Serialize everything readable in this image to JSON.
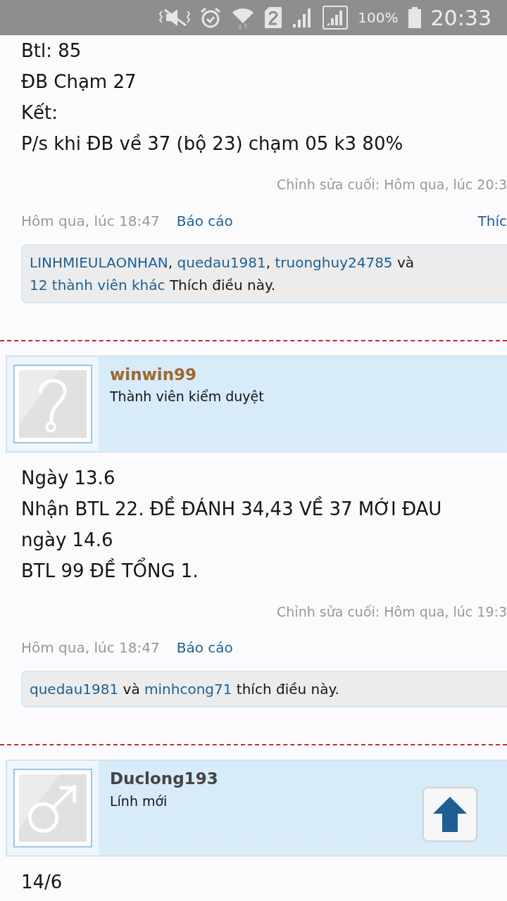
{
  "status_bar": {
    "battery": "100%",
    "time": "20:33"
  },
  "posts": [
    {
      "body": [
        "Btl: 85",
        "ĐB Chạm 27",
        "Kết:",
        "P/s khi ĐB về 37 (bộ 23) chạm 05 k3 80%"
      ],
      "edited": "Chỉnh sửa cuối: Hôm qua, lúc 20:3",
      "time": "Hôm qua, lúc 18:47",
      "report": "Báo cáo",
      "like": "Thíc",
      "likes": [
        {
          "text": "LINHMIEULAONHAN",
          "link": true
        },
        {
          "text": ", ",
          "link": false
        },
        {
          "text": "quedau1981",
          "link": true
        },
        {
          "text": ", ",
          "link": false
        },
        {
          "text": "truonghuy24785",
          "link": true
        },
        {
          "text": " và ",
          "link": false
        },
        {
          "text": "12 thành viên khác",
          "link": true
        },
        {
          "text": " Thích điều này.",
          "link": false
        }
      ]
    },
    {
      "user": {
        "name": "winwin99",
        "role": "Thành viên kiểm duyệt",
        "kind": "unknown",
        "color": "#a0652e"
      },
      "body": [
        "Ngày 13.6",
        "Nhận BTL 22. ĐỀ ĐÁNH 34,43 VỀ 37 MỚI ĐAU",
        "ngày 14.6",
        "BTL 99 ĐỀ TỔNG 1."
      ],
      "edited": "Chỉnh sửa cuối: Hôm qua, lúc 19:3",
      "time": "Hôm qua, lúc 18:47",
      "report": "Báo cáo",
      "likes": [
        {
          "text": "quedau1981",
          "link": true
        },
        {
          "text": " và ",
          "link": false
        },
        {
          "text": "minhcong71",
          "link": true
        },
        {
          "text": " thích điều này.",
          "link": false
        }
      ]
    },
    {
      "user": {
        "name": "Duclong193",
        "role": "Lính mới",
        "kind": "male",
        "color": "#444444"
      },
      "body": [
        "14/6"
      ]
    }
  ]
}
